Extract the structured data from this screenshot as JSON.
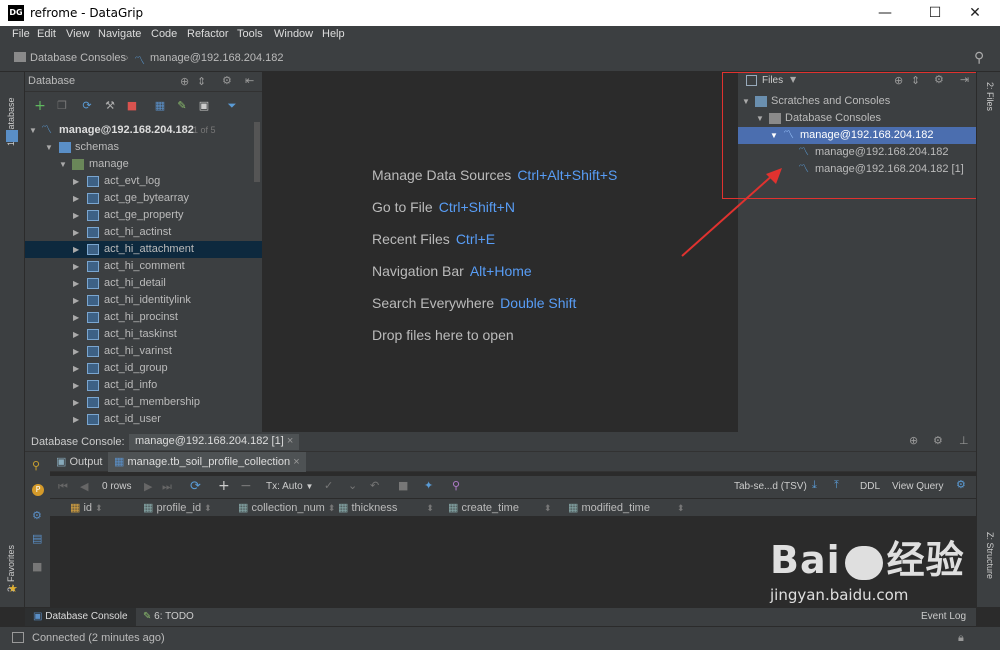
{
  "window": {
    "app_icon": "DG",
    "title": "refrome - DataGrip",
    "minimize": "—",
    "maximize": "☐",
    "close": "✕"
  },
  "menu": [
    "File",
    "Edit",
    "View",
    "Navigate",
    "Code",
    "Refactor",
    "Tools",
    "Window",
    "Help"
  ],
  "breadcrumb": {
    "first": "Database Consoles",
    "second": "manage@192.168.204.182"
  },
  "left_strip": {
    "database_tab": "1: Database",
    "favorites_tab": "2: Favorites"
  },
  "database_panel": {
    "title": "Database",
    "tree": {
      "root": {
        "label": "manage@192.168.204.182",
        "count": "1 of 5"
      },
      "schemas": "schemas",
      "schema": "manage",
      "tables": [
        "act_evt_log",
        "act_ge_bytearray",
        "act_ge_property",
        "act_hi_actinst",
        "act_hi_attachment",
        "act_hi_comment",
        "act_hi_detail",
        "act_hi_identitylink",
        "act_hi_procinst",
        "act_hi_taskinst",
        "act_hi_varinst",
        "act_id_group",
        "act_id_info",
        "act_id_membership",
        "act_id_user"
      ],
      "selected_index": 4
    }
  },
  "center_hints": [
    {
      "label": "Manage Data Sources",
      "key": "Ctrl+Alt+Shift+S"
    },
    {
      "label": "Go to File",
      "key": "Ctrl+Shift+N"
    },
    {
      "label": "Recent Files",
      "key": "Ctrl+E"
    },
    {
      "label": "Navigation Bar",
      "key": "Alt+Home"
    },
    {
      "label": "Search Everywhere",
      "key": "Double Shift"
    },
    {
      "label": "Drop files here to open",
      "key": ""
    }
  ],
  "files_panel": {
    "title": "Files",
    "tree": {
      "scratches": "Scratches and Consoles",
      "db_consoles": "Database Consoles",
      "selected": "manage@192.168.204.182",
      "children": [
        "manage@192.168.204.182",
        "manage@192.168.204.182 [1]"
      ]
    }
  },
  "right_strip": {
    "files_tab": "2: Files",
    "structure_tab": "Z: Structure"
  },
  "console": {
    "title": "Database Console:",
    "tab": "manage@192.168.204.182 [1]",
    "subtabs": [
      "Output",
      "manage.tb_soil_profile_collection"
    ],
    "rows": "0 rows",
    "tx": "Tx: Auto",
    "format": "Tab-se...d (TSV)",
    "ddl": "DDL",
    "view_query": "View Query",
    "columns": [
      "id",
      "profile_id",
      "collection_num",
      "thickness",
      "create_time",
      "modified_time"
    ]
  },
  "bottom_tabs": {
    "db_console": "Database Console",
    "todo": "6: TODO",
    "event_log": "Event Log"
  },
  "status": "Connected (2 minutes ago)",
  "watermark": {
    "brand": "Bai",
    "brand2": "经验",
    "url": "jingyan.baidu.com"
  },
  "colors": {
    "accent": "#589df6",
    "selection": "#4b6eaf",
    "annotation": "#e0322f"
  }
}
